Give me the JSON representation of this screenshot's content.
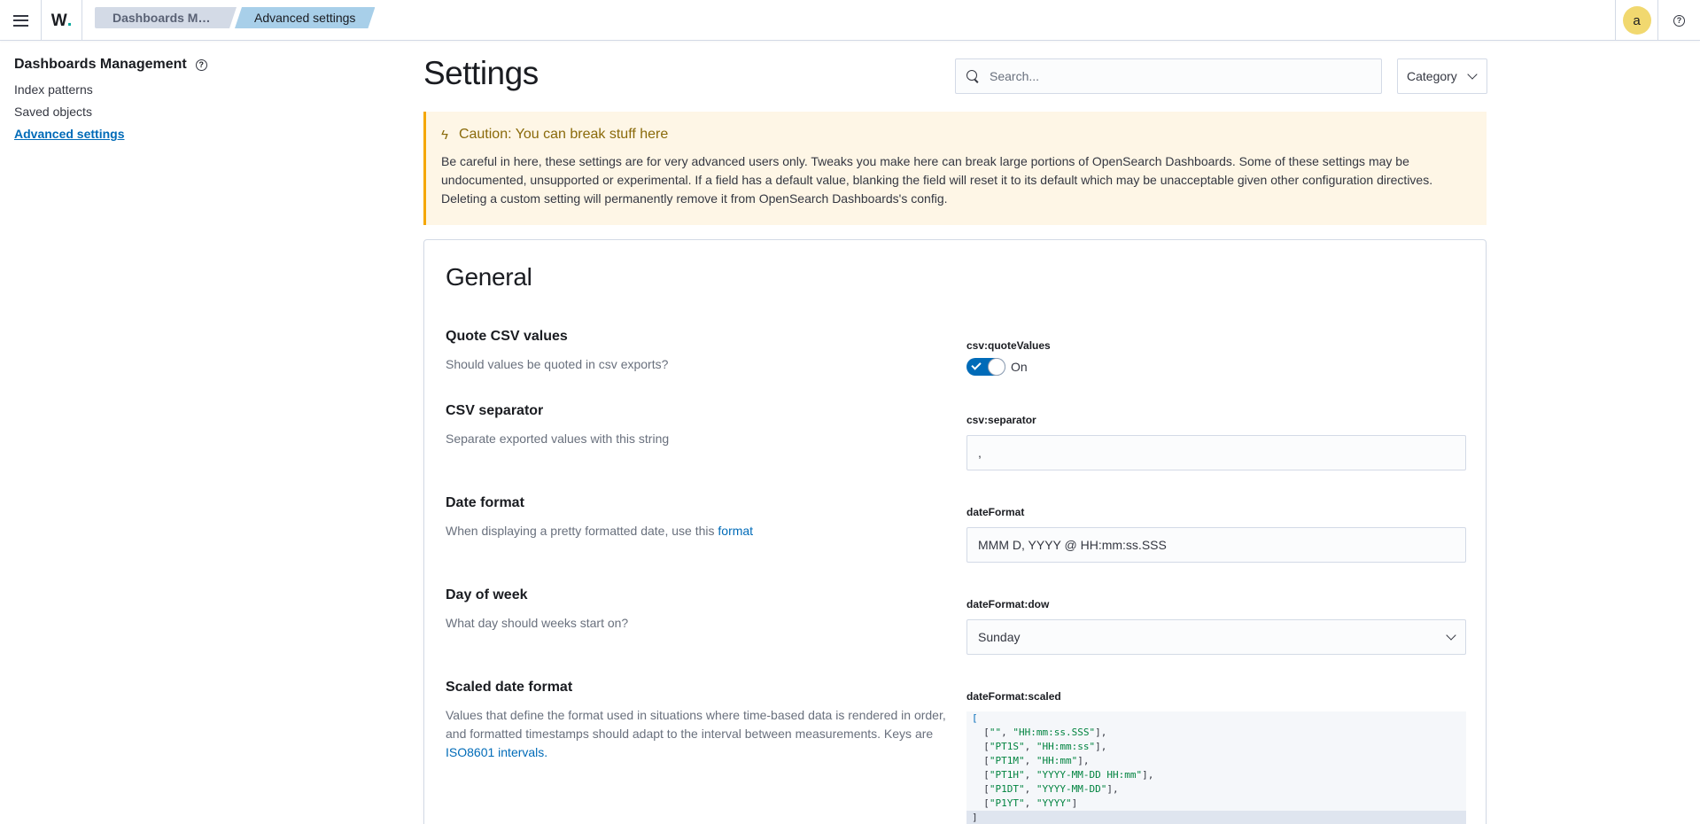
{
  "header": {
    "breadcrumbs": [
      "Dashboards Management",
      "Advanced settings"
    ],
    "avatar_initial": "a"
  },
  "sidebar": {
    "title": "Dashboards Management",
    "items": [
      "Index patterns",
      "Saved objects",
      "Advanced settings"
    ],
    "active_index": 2
  },
  "main": {
    "title": "Settings",
    "search_placeholder": "Search...",
    "category_label": "Category"
  },
  "callout": {
    "title": "Caution: You can break stuff here",
    "body": "Be careful in here, these settings are for very advanced users only. Tweaks you make here can break large portions of OpenSearch Dashboards. Some of these settings may be undocumented, unsupported or experimental. If a field has a default value, blanking the field will reset it to its default which may be unacceptable given other configuration directives. Deleting a custom setting will permanently remove it from OpenSearch Dashboards's config."
  },
  "section": {
    "title": "General",
    "settings": {
      "quote_csv": {
        "title": "Quote CSV values",
        "desc": "Should values be quoted in csv exports?",
        "key": "csv:quoteValues",
        "value_label": "On",
        "enabled": true
      },
      "csv_sep": {
        "title": "CSV separator",
        "desc": "Separate exported values with this string",
        "key": "csv:separator",
        "value": ","
      },
      "date_format": {
        "title": "Date format",
        "desc_prefix": "When displaying a pretty formatted date, use this ",
        "desc_link": "format",
        "key": "dateFormat",
        "value": "MMM D, YYYY @ HH:mm:ss.SSS"
      },
      "dow": {
        "title": "Day of week",
        "desc": "What day should weeks start on?",
        "key": "dateFormat:dow",
        "value": "Sunday"
      },
      "scaled": {
        "title": "Scaled date format",
        "desc_prefix": "Values that define the format used in situations where time-based data is rendered in order, and formatted timestamps should adapt to the interval between measurements. Keys are ",
        "desc_link": "ISO8601 intervals.",
        "key": "dateFormat:scaled",
        "code_open": "[",
        "code_close": "]",
        "code_rows": [
          [
            "\"\"",
            "\"HH:mm:ss.SSS\""
          ],
          [
            "\"PT1S\"",
            "\"HH:mm:ss\""
          ],
          [
            "\"PT1M\"",
            "\"HH:mm\""
          ],
          [
            "\"PT1H\"",
            "\"YYYY-MM-DD HH:mm\""
          ],
          [
            "\"P1DT\"",
            "\"YYYY-MM-DD\""
          ],
          [
            "\"P1YT\"",
            "\"YYYY\""
          ]
        ]
      }
    }
  }
}
